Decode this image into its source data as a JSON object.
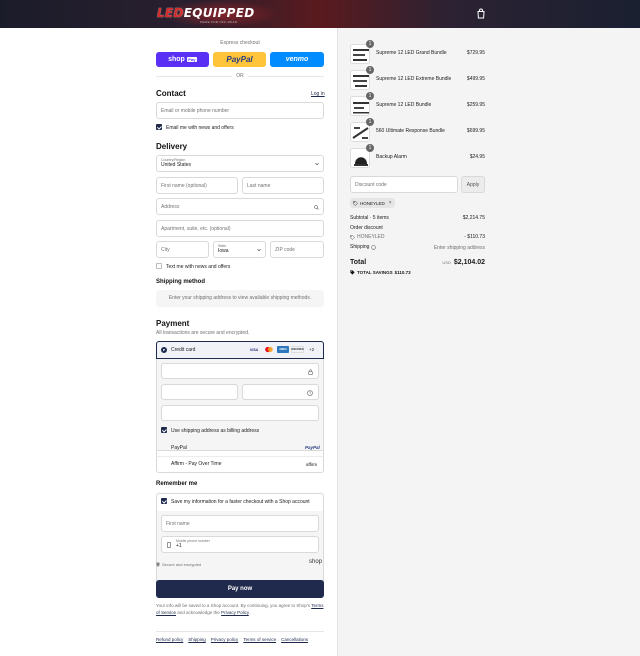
{
  "header": {
    "logo_led": "LED",
    "logo_equipped": "EQUIPPED",
    "logo_sub": "MADE FOR OFF-ROAD",
    "cart_icon": "shopping-bag-icon"
  },
  "express": {
    "title": "Express checkout",
    "shop_pay": "shop",
    "shop_pay_badge": "Pay",
    "paypal": "PayPal",
    "venmo": "venmo",
    "or": "OR"
  },
  "contact": {
    "heading": "Contact",
    "login": "Log in",
    "email_placeholder": "Email or mobile phone number",
    "news_label": "Email me with news and offers"
  },
  "delivery": {
    "heading": "Delivery",
    "country_label": "Country/Region",
    "country_value": "United States",
    "first_name": "First name (optional)",
    "last_name": "Last name",
    "address": "Address",
    "apartment": "Apartment, suite, etc. (optional)",
    "city": "City",
    "state_label": "State",
    "state_value": "Iowa",
    "zip": "ZIP code",
    "text_label": "Text me with news and offers"
  },
  "shipping": {
    "heading": "Shipping method",
    "note": "Enter your shipping address to view available shipping methods."
  },
  "payment": {
    "heading": "Payment",
    "subtitle": "All transactions are secure and encrypted.",
    "credit_card": "Credit card",
    "more_cards": "+2",
    "card_visa": "VISA",
    "card_amex": "AMEX",
    "card_discover": "DISCOVER",
    "billing_label": "Use shipping address as billing address",
    "paypal": "PayPal",
    "paypal_logo": "PayPal",
    "affirm": "Affirm - Pay Over Time",
    "affirm_logo": "affirm"
  },
  "remember": {
    "heading": "Remember me",
    "save_label": "Save my information for a faster checkout with a Shop account",
    "first_name": "First name",
    "phone_label": "Mobile phone number",
    "phone_value": "+1",
    "secure": "Secure and encrypted",
    "shop": "shop"
  },
  "pay_now": "Pay now",
  "legal": {
    "line1": "Your info will be saved to a Shop account. By continuing, you agree to Shop's",
    "tos": "Terms of Service",
    "and": "and acknowledge the",
    "privacy": "Privacy Policy",
    "end": "."
  },
  "footer_links": [
    "Refund policy",
    "Shipping",
    "Privacy policy",
    "Terms of service",
    "Cancellations"
  ],
  "cart": {
    "items": [
      {
        "name": "Supreme 12 LED Grand Bundle",
        "price": "$729.95",
        "qty": "1"
      },
      {
        "name": "Supreme 12 LED Extreme Bundle",
        "price": "$499.95",
        "qty": "1"
      },
      {
        "name": "Supreme 12 LED Bundle",
        "price": "$259.95",
        "qty": "1"
      },
      {
        "name": "560 Ultimate Response Bundle",
        "price": "$699.95",
        "qty": "1"
      },
      {
        "name": "Backup Alarm",
        "price": "$24.95",
        "qty": "1"
      }
    ],
    "discount_placeholder": "Discount code",
    "apply": "Apply",
    "code_tag": "HONEYLED",
    "subtotal_label": "Subtotal · 5 items",
    "subtotal_value": "$2,214.75",
    "order_discount": "Order discount",
    "discount_code": "HONEYLED",
    "discount_value": "- $110.73",
    "shipping_label": "Shipping",
    "shipping_value": "Enter shipping address",
    "total_label": "Total",
    "currency": "USD",
    "total_value": "$2,104.02",
    "savings_label": "TOTAL SAVINGS",
    "savings_value": "$110.73"
  }
}
